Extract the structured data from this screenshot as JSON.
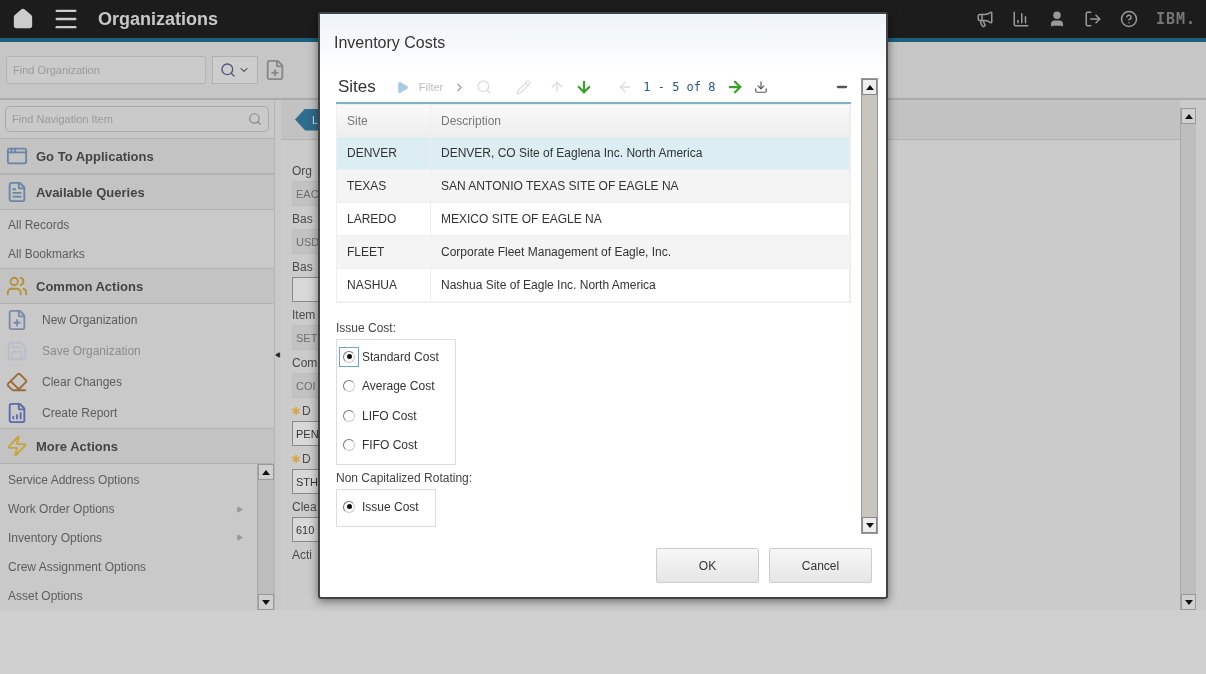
{
  "app_bar": {
    "title": "Organizations",
    "logo": "IBM."
  },
  "toolbar": {
    "search": {
      "placeholder": "Find Organization"
    }
  },
  "sidebar": {
    "search": {
      "placeholder": "Find Navigation Item"
    },
    "sections": [
      {
        "title": "Go To Applications",
        "kind": "apps"
      },
      {
        "title": "Available Queries",
        "kind": "queries",
        "items": [
          {
            "label": "All Records"
          },
          {
            "label": "All Bookmarks"
          }
        ]
      },
      {
        "title": "Common Actions",
        "kind": "actions",
        "items": [
          {
            "label": "New Organization",
            "kind": "new",
            "disabled": false
          },
          {
            "label": "Save Organization",
            "kind": "save",
            "disabled": true
          },
          {
            "label": "Clear Changes",
            "kind": "clear",
            "disabled": false
          },
          {
            "label": "Create Report",
            "kind": "report",
            "disabled": false
          }
        ]
      },
      {
        "title": "More Actions",
        "kind": "more",
        "items": [
          {
            "label": "Service Address Options",
            "submenu": false
          },
          {
            "label": "Work Order Options",
            "submenu": true
          },
          {
            "label": "Inventory Options",
            "submenu": true
          },
          {
            "label": "Crew Assignment Options",
            "submenu": false
          },
          {
            "label": "Asset Options",
            "submenu": false
          }
        ]
      }
    ]
  },
  "main": {
    "tab": {
      "label": "L"
    },
    "fields": [
      {
        "label": "Org",
        "value": "EAC",
        "readonly": true,
        "required": false
      },
      {
        "label": "Bas",
        "value": "USD",
        "readonly": true,
        "required": false
      },
      {
        "label": "Bas",
        "readonly": false,
        "required": false
      },
      {
        "label": "Item",
        "value": "SET",
        "readonly": true,
        "required": false
      },
      {
        "label": "Com",
        "value": "COI",
        "readonly": true,
        "required": false
      },
      {
        "label": "D",
        "value": "PEN",
        "readonly": false,
        "required": true
      },
      {
        "label": "D",
        "value": "STH",
        "readonly": false,
        "required": true
      },
      {
        "label": "Clea",
        "value": "610",
        "readonly": false,
        "required": false
      },
      {
        "label": "Acti",
        "required": false
      }
    ]
  },
  "dialog": {
    "title": "Inventory Costs",
    "table": {
      "title": "Sites",
      "filter": "Filter",
      "pagination": "1 - 5 of 8",
      "columns": [
        "Site",
        "Description"
      ],
      "rows": [
        {
          "cells": [
            "DENVER",
            "DENVER, CO Site of Eaglena Inc. North America"
          ],
          "selected": true
        },
        {
          "cells": [
            "TEXAS",
            "SAN ANTONIO TEXAS SITE OF EAGLE NA"
          ],
          "selected": false
        },
        {
          "cells": [
            "LAREDO",
            "MEXICO SITE OF EAGLE NA"
          ],
          "selected": false
        },
        {
          "cells": [
            "FLEET",
            "Corporate Fleet Management of Eagle, Inc."
          ],
          "selected": false
        },
        {
          "cells": [
            "NASHUA",
            "Nashua Site of Eagle Inc. North America"
          ],
          "selected": false
        }
      ]
    },
    "radio_groups": [
      {
        "label": "Issue Cost:",
        "options": [
          {
            "label": "Standard Cost",
            "selected": true,
            "focused": true
          },
          {
            "label": "Average Cost",
            "selected": false,
            "focused": false
          },
          {
            "label": "LIFO Cost",
            "selected": false,
            "focused": false
          },
          {
            "label": "FIFO Cost",
            "selected": false,
            "focused": false
          }
        ]
      },
      {
        "label": "Non Capitalized Rotating:",
        "options": [
          {
            "label": "Issue Cost",
            "selected": true,
            "focused": false
          }
        ]
      }
    ],
    "buttons": [
      "OK",
      "Cancel"
    ]
  }
}
